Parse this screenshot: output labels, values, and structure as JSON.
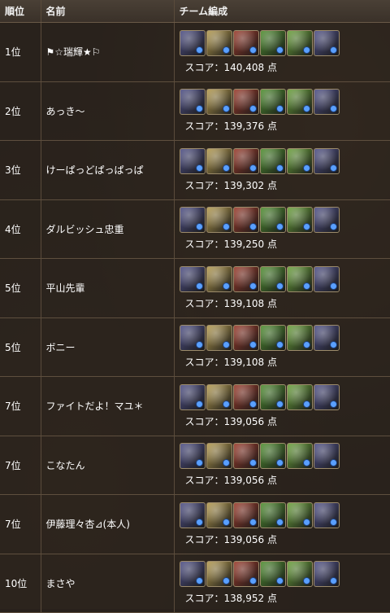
{
  "headers": {
    "rank": "順位",
    "name": "名前",
    "team": "チーム編成"
  },
  "score_prefix": "スコア：",
  "score_suffix": " 点",
  "monster_colors": {
    "dark-dragon": "#4e4f86",
    "light-knight": "#b49a4e",
    "fire-demon": "#9a3a2a",
    "green-dragon": "#4f8f2f",
    "green-dragon-alt": "#6aa23a"
  },
  "rows": [
    {
      "rank": "1位",
      "name": "⚑☆瑞輝★⚐",
      "score": "140,408",
      "team": [
        "dark-dragon",
        "light-knight",
        "fire-demon",
        "green-dragon",
        "green-dragon-alt",
        "dark-dragon"
      ]
    },
    {
      "rank": "2位",
      "name": "あっき〜",
      "score": "139,376",
      "team": [
        "dark-dragon",
        "light-knight",
        "fire-demon",
        "green-dragon",
        "green-dragon-alt",
        "dark-dragon"
      ]
    },
    {
      "rank": "3位",
      "name": "けーぱっどぱっぱっぱ",
      "score": "139,302",
      "team": [
        "dark-dragon",
        "light-knight",
        "fire-demon",
        "green-dragon",
        "green-dragon-alt",
        "dark-dragon"
      ]
    },
    {
      "rank": "4位",
      "name": "ダルビッシュ忠重",
      "score": "139,250",
      "team": [
        "dark-dragon",
        "light-knight",
        "fire-demon",
        "green-dragon",
        "green-dragon-alt",
        "dark-dragon"
      ]
    },
    {
      "rank": "5位",
      "name": "平山先輩",
      "score": "139,108",
      "team": [
        "dark-dragon",
        "light-knight",
        "fire-demon",
        "green-dragon",
        "green-dragon-alt",
        "dark-dragon"
      ]
    },
    {
      "rank": "5位",
      "name": "ボニー",
      "score": "139,108",
      "team": [
        "dark-dragon",
        "light-knight",
        "fire-demon",
        "green-dragon",
        "green-dragon-alt",
        "dark-dragon"
      ]
    },
    {
      "rank": "7位",
      "name": "ファイトだよ！マユ＊",
      "score": "139,056",
      "team": [
        "dark-dragon",
        "light-knight",
        "fire-demon",
        "green-dragon",
        "green-dragon-alt",
        "dark-dragon"
      ]
    },
    {
      "rank": "7位",
      "name": "こなたん",
      "score": "139,056",
      "team": [
        "dark-dragon",
        "light-knight",
        "fire-demon",
        "green-dragon",
        "green-dragon-alt",
        "dark-dragon"
      ]
    },
    {
      "rank": "7位",
      "name": "伊藤理々杏⊿(本人)",
      "score": "139,056",
      "team": [
        "dark-dragon",
        "light-knight",
        "fire-demon",
        "green-dragon",
        "green-dragon-alt",
        "dark-dragon"
      ]
    },
    {
      "rank": "10位",
      "name": "まさや",
      "score": "138,952",
      "team": [
        "dark-dragon",
        "light-knight",
        "fire-demon",
        "green-dragon",
        "green-dragon-alt",
        "dark-dragon"
      ]
    }
  ]
}
